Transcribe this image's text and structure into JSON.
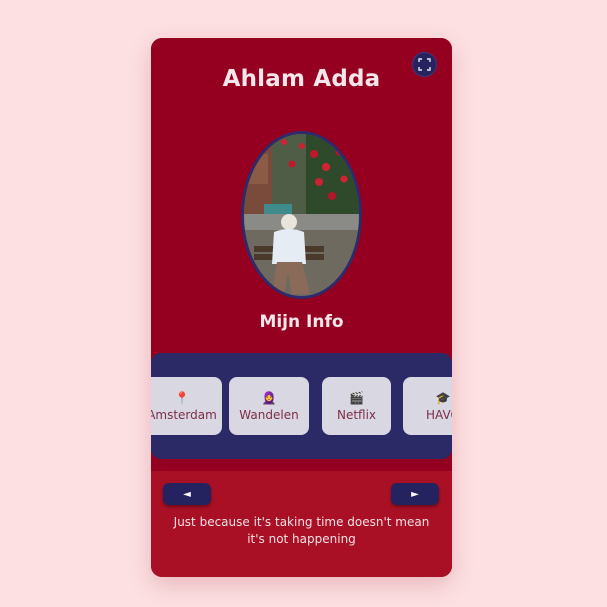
{
  "profile": {
    "name": "Ahlam Adda",
    "section_title": "Mijn Info"
  },
  "icons": {
    "expand": "fullscreen-icon"
  },
  "interests": [
    {
      "label": "Amsterdam",
      "icon": "📍"
    },
    {
      "label": "Wandelen",
      "icon": "🧕"
    },
    {
      "label": "Netflix",
      "icon": "🎬"
    },
    {
      "label": "HAVO",
      "icon": "🎓"
    }
  ],
  "nav": {
    "prev_label": "◄",
    "next_label": "►"
  },
  "quote": "Just because it's taking time doesn't mean it's not happening",
  "colors": {
    "page_bg": "#fde0e2",
    "card_top": "#960020",
    "strip": "#2c2a66",
    "bottom": "#a91025",
    "button": "#25235f"
  }
}
